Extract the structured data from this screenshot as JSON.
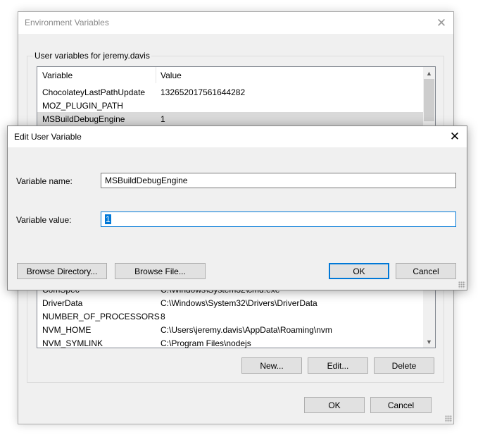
{
  "env_dialog": {
    "title": "Environment Variables",
    "group_label": "User variables for jeremy.davis",
    "columns": [
      "Variable",
      "Value"
    ],
    "top_rows": [
      {
        "variable": "ChocolateyLastPathUpdate",
        "value": "132652017561644282"
      },
      {
        "variable": "MOZ_PLUGIN_PATH",
        "value": ""
      },
      {
        "variable": "MSBuildDebugEngine",
        "value": "1"
      }
    ],
    "bottom_rows": [
      {
        "variable": "ComSpec",
        "value": "C:\\Windows\\System32\\cmd.exe"
      },
      {
        "variable": "DriverData",
        "value": "C:\\Windows\\System32\\Drivers\\DriverData"
      },
      {
        "variable": "NUMBER_OF_PROCESSORS",
        "value": "8"
      },
      {
        "variable": "NVM_HOME",
        "value": "C:\\Users\\jeremy.davis\\AppData\\Roaming\\nvm"
      },
      {
        "variable": "NVM_SYMLINK",
        "value": "C:\\Program Files\\nodejs"
      }
    ],
    "buttons": {
      "new": "New...",
      "edit": "Edit...",
      "delete": "Delete",
      "ok": "OK",
      "cancel": "Cancel"
    }
  },
  "edit_dialog": {
    "title": "Edit User Variable",
    "name_label": "Variable name:",
    "name_value": "MSBuildDebugEngine",
    "value_label": "Variable value:",
    "value_value": "1",
    "buttons": {
      "browse_directory": "Browse Directory...",
      "browse_file": "Browse File...",
      "ok": "OK",
      "cancel": "Cancel"
    }
  },
  "icons": [
    "close-icon",
    "scroll-up-icon",
    "scroll-down-icon",
    "resize-grip-icon"
  ],
  "colors": {
    "accent": "#0078d7",
    "dialog_bg": "#f0f0f0",
    "selected_row": "#d9d9d9"
  }
}
